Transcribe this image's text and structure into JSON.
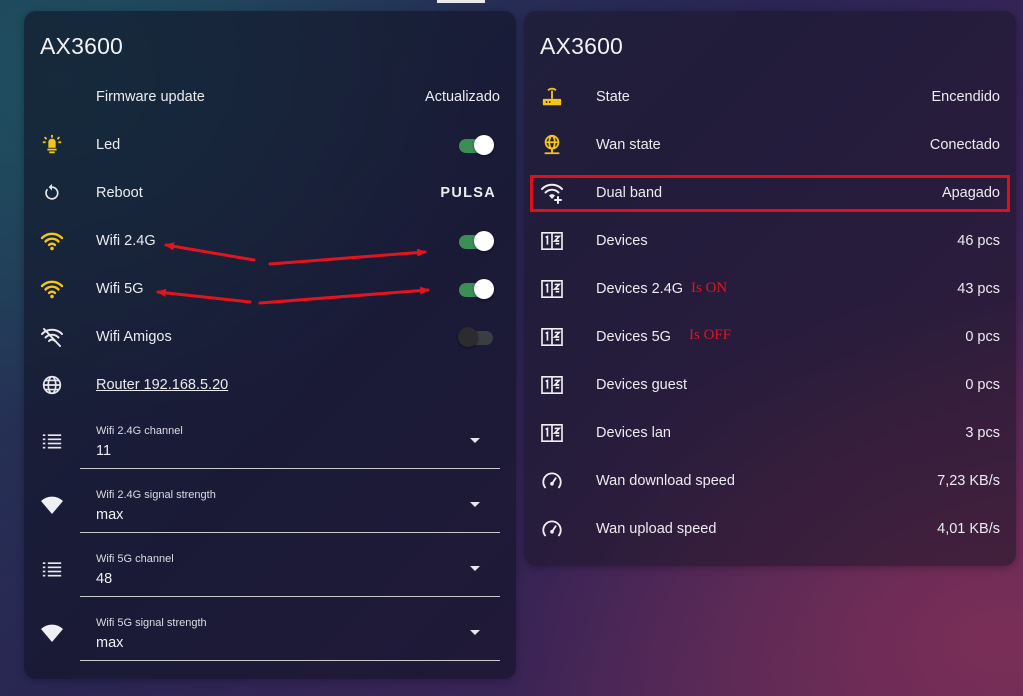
{
  "colors": {
    "accent_orange": "#f0a020",
    "icon_yellow": "#f5c518",
    "toggle_on": "#3d8e55",
    "annotation_red": "#e3141d"
  },
  "left_card": {
    "title": "AX3600",
    "firmware": {
      "label": "Firmware update",
      "value": "Actualizado"
    },
    "led": {
      "label": "Led",
      "icon": "led-bulb-icon",
      "state": "on"
    },
    "reboot": {
      "label": "Reboot",
      "icon": "restart-icon",
      "action": "PULSA"
    },
    "wifi24": {
      "label": "Wifi 2.4G",
      "icon": "wifi-icon",
      "state": "on"
    },
    "wifi5": {
      "label": "Wifi 5G",
      "icon": "wifi-icon",
      "state": "on"
    },
    "wifi_amigos": {
      "label": "Wifi Amigos",
      "icon": "wifi-off-icon",
      "state": "off"
    },
    "router_link": {
      "text": "Router 192.168.5.20",
      "icon": "globe-icon"
    },
    "selects": [
      {
        "label": "Wifi 2.4G channel",
        "value": "11",
        "icon": "list-icon"
      },
      {
        "label": "Wifi 2.4G signal strength",
        "value": "max",
        "icon": "wifi-strength-icon"
      },
      {
        "label": "Wifi 5G channel",
        "value": "48",
        "icon": "list-icon"
      },
      {
        "label": "Wifi 5G signal strength",
        "value": "max",
        "icon": "wifi-strength-icon"
      }
    ]
  },
  "right_card": {
    "title": "AX3600",
    "rows": [
      {
        "label": "State",
        "value": "Encendido",
        "icon": "router-icon"
      },
      {
        "label": "Wan state",
        "value": "Conectado",
        "icon": "wan-globe-icon"
      },
      {
        "label": "Dual band",
        "value": "Apagado",
        "icon": "wifi-plus-icon"
      },
      {
        "label": "Devices",
        "value": "46 pcs",
        "icon": "devices-counter-icon"
      },
      {
        "label": "Devices 2.4G",
        "value": "43 pcs",
        "icon": "devices-counter-icon"
      },
      {
        "label": "Devices 5G",
        "value": "0 pcs",
        "icon": "devices-counter-icon"
      },
      {
        "label": "Devices guest",
        "value": "0 pcs",
        "icon": "devices-counter-icon"
      },
      {
        "label": "Devices lan",
        "value": "3 pcs",
        "icon": "devices-counter-icon"
      },
      {
        "label": "Wan download speed",
        "value": "7,23 KB/s",
        "icon": "speedometer-icon"
      },
      {
        "label": "Wan upload speed",
        "value": "4,01 KB/s",
        "icon": "speedometer-icon"
      }
    ]
  },
  "annotations": {
    "is_on": "Is ON",
    "is_off": "Is OFF"
  }
}
